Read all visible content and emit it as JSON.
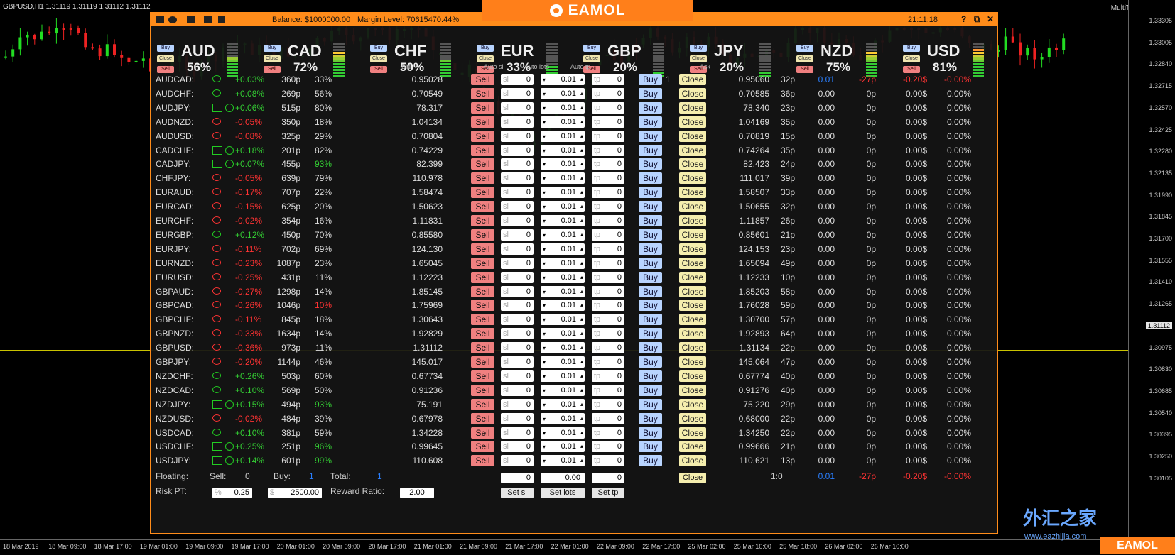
{
  "symbol_info": "GBPUSD,H1  1.31119 1.31119 1.31112 1.31112",
  "multitrader_label": "MultiTrader",
  "brand": "EAMOL",
  "watermark": {
    "text": "外汇之家",
    "url": "www.eazhijia.com"
  },
  "price_scale": [
    "1.33305",
    "1.33005",
    "1.32840",
    "1.32715",
    "1.32570",
    "1.32425",
    "1.32280",
    "1.32135",
    "1.31990",
    "1.31845",
    "1.31700",
    "1.31555",
    "1.31410",
    "1.31265",
    "1.31112",
    "1.30975",
    "1.30830",
    "1.30685",
    "1.30540",
    "1.30395",
    "1.30250",
    "1.30105"
  ],
  "time_scale": [
    "18 Mar 2019",
    "18 Mar 09:00",
    "18 Mar 17:00",
    "19 Mar 01:00",
    "19 Mar 09:00",
    "19 Mar 17:00",
    "20 Mar 01:00",
    "20 Mar 09:00",
    "20 Mar 17:00",
    "21 Mar 01:00",
    "21 Mar 09:00",
    "21 Mar 17:00",
    "22 Mar 01:00",
    "22 Mar 09:00",
    "22 Mar 17:00",
    "25 Mar 02:00",
    "25 Mar 10:00",
    "25 Mar 18:00",
    "26 Mar 02:00",
    "26 Mar 10:00"
  ],
  "titlebar": {
    "balance": "Balance: $1000000.00",
    "margin": "Margin Level: 70615470.44%",
    "time": "21:11:18",
    "help": "?",
    "restore": "⧉",
    "close": "✕"
  },
  "currencies": [
    {
      "name": "AUD",
      "pct": "56%",
      "buy": "Buy",
      "close": "Close",
      "sell": "Sell",
      "level": 0.56
    },
    {
      "name": "CAD",
      "pct": "72%",
      "buy": "Buy",
      "close": "Close",
      "sell": "Sell",
      "level": 0.72
    },
    {
      "name": "CHF",
      "pct": "50%",
      "buy": "Buy",
      "close": "Close",
      "sell": "Sell",
      "level": 0.5
    },
    {
      "name": "EUR",
      "pct": "33%",
      "buy": "Buy",
      "close": "Close",
      "sell": "Sell",
      "level": 0.33
    },
    {
      "name": "GBP",
      "pct": "20%",
      "buy": "Buy",
      "close": "Close",
      "sell": "Sell",
      "level": 0.2
    },
    {
      "name": "JPY",
      "pct": "20%",
      "buy": "Buy",
      "close": "Close",
      "sell": "Sell",
      "level": 0.2
    },
    {
      "name": "NZD",
      "pct": "75%",
      "buy": "Buy",
      "close": "Close",
      "sell": "Sell",
      "level": 0.75
    },
    {
      "name": "USD",
      "pct": "81%",
      "buy": "Buy",
      "close": "Close",
      "sell": "Sell",
      "level": 0.81
    }
  ],
  "headers": {
    "bid": "Bid",
    "auto_sl": "Auto sl",
    "auto_lots": "Auto lots",
    "auto_tp": "Auto tp",
    "ask": "Ask"
  },
  "labels": {
    "sell": "Sell",
    "buy": "Buy",
    "close": "Close",
    "sl": "sl",
    "tp": "tp"
  },
  "rows": [
    {
      "pair": "AUDCAD:",
      "chg": "+0.03%",
      "sp": "360p",
      "pct": "33%",
      "bid": "0.95028",
      "sl": "0",
      "lots": "0.01",
      "tp": "0",
      "ask": "0.95060",
      "asp": "32p",
      "pnl": "0.01",
      "pips": "-27p",
      "usd": "-0.20$",
      "ppc": "-0.00%",
      "ord": "1",
      "up": true
    },
    {
      "pair": "AUDCHF:",
      "chg": "+0.08%",
      "sp": "269p",
      "pct": "56%",
      "bid": "0.70549",
      "sl": "0",
      "lots": "0.01",
      "tp": "0",
      "ask": "0.70585",
      "asp": "36p",
      "pnl": "0.00",
      "pips": "0p",
      "usd": "0.00$",
      "ppc": "0.00%",
      "up": true
    },
    {
      "pair": "AUDJPY:",
      "chg": "+0.06%",
      "sp": "515p",
      "pct": "80%",
      "bid": "78.317",
      "sl": "0",
      "lots": "0.01",
      "tp": "0",
      "ask": "78.340",
      "asp": "23p",
      "pnl": "0.00",
      "pips": "0p",
      "usd": "0.00$",
      "ppc": "0.00%",
      "up": true,
      "sq": true
    },
    {
      "pair": "AUDNZD:",
      "chg": "-0.05%",
      "sp": "350p",
      "pct": "18%",
      "bid": "1.04134",
      "sl": "0",
      "lots": "0.01",
      "tp": "0",
      "ask": "1.04169",
      "asp": "35p",
      "pnl": "0.00",
      "pips": "0p",
      "usd": "0.00$",
      "ppc": "0.00%",
      "up": false
    },
    {
      "pair": "AUDUSD:",
      "chg": "-0.08%",
      "sp": "325p",
      "pct": "29%",
      "bid": "0.70804",
      "sl": "0",
      "lots": "0.01",
      "tp": "0",
      "ask": "0.70819",
      "asp": "15p",
      "pnl": "0.00",
      "pips": "0p",
      "usd": "0.00$",
      "ppc": "0.00%",
      "up": false
    },
    {
      "pair": "CADCHF:",
      "chg": "+0.18%",
      "sp": "201p",
      "pct": "82%",
      "bid": "0.74229",
      "sl": "0",
      "lots": "0.01",
      "tp": "0",
      "ask": "0.74264",
      "asp": "35p",
      "pnl": "0.00",
      "pips": "0p",
      "usd": "0.00$",
      "ppc": "0.00%",
      "up": true,
      "sq": true
    },
    {
      "pair": "CADJPY:",
      "chg": "+0.07%",
      "sp": "455p",
      "pct": "93%",
      "pc": "g",
      "bid": "82.399",
      "sl": "0",
      "lots": "0.01",
      "tp": "0",
      "ask": "82.423",
      "asp": "24p",
      "pnl": "0.00",
      "pips": "0p",
      "usd": "0.00$",
      "ppc": "0.00%",
      "up": true,
      "sq": true
    },
    {
      "pair": "CHFJPY:",
      "chg": "-0.05%",
      "sp": "639p",
      "pct": "79%",
      "bid": "110.978",
      "sl": "0",
      "lots": "0.01",
      "tp": "0",
      "ask": "111.017",
      "asp": "39p",
      "pnl": "0.00",
      "pips": "0p",
      "usd": "0.00$",
      "ppc": "0.00%",
      "up": false
    },
    {
      "pair": "EURAUD:",
      "chg": "-0.17%",
      "sp": "707p",
      "pct": "22%",
      "bid": "1.58474",
      "sl": "0",
      "lots": "0.01",
      "tp": "0",
      "ask": "1.58507",
      "asp": "33p",
      "pnl": "0.00",
      "pips": "0p",
      "usd": "0.00$",
      "ppc": "0.00%",
      "up": false
    },
    {
      "pair": "EURCAD:",
      "chg": "-0.15%",
      "sp": "625p",
      "pct": "20%",
      "bid": "1.50623",
      "sl": "0",
      "lots": "0.01",
      "tp": "0",
      "ask": "1.50655",
      "asp": "32p",
      "pnl": "0.00",
      "pips": "0p",
      "usd": "0.00$",
      "ppc": "0.00%",
      "up": false
    },
    {
      "pair": "EURCHF:",
      "chg": "-0.02%",
      "sp": "354p",
      "pct": "16%",
      "bid": "1.11831",
      "sl": "0",
      "lots": "0.01",
      "tp": "0",
      "ask": "1.11857",
      "asp": "26p",
      "pnl": "0.00",
      "pips": "0p",
      "usd": "0.00$",
      "ppc": "0.00%",
      "up": false
    },
    {
      "pair": "EURGBP:",
      "chg": "+0.12%",
      "sp": "450p",
      "pct": "70%",
      "bid": "0.85580",
      "sl": "0",
      "lots": "0.01",
      "tp": "0",
      "ask": "0.85601",
      "asp": "21p",
      "pnl": "0.00",
      "pips": "0p",
      "usd": "0.00$",
      "ppc": "0.00%",
      "up": true
    },
    {
      "pair": "EURJPY:",
      "chg": "-0.11%",
      "sp": "702p",
      "pct": "69%",
      "bid": "124.130",
      "sl": "0",
      "lots": "0.01",
      "tp": "0",
      "ask": "124.153",
      "asp": "23p",
      "pnl": "0.00",
      "pips": "0p",
      "usd": "0.00$",
      "ppc": "0.00%",
      "up": false
    },
    {
      "pair": "EURNZD:",
      "chg": "-0.23%",
      "sp": "1087p",
      "pct": "23%",
      "bid": "1.65045",
      "sl": "0",
      "lots": "0.01",
      "tp": "0",
      "ask": "1.65094",
      "asp": "49p",
      "pnl": "0.00",
      "pips": "0p",
      "usd": "0.00$",
      "ppc": "0.00%",
      "up": false
    },
    {
      "pair": "EURUSD:",
      "chg": "-0.25%",
      "sp": "431p",
      "pct": "11%",
      "bid": "1.12223",
      "sl": "0",
      "lots": "0.01",
      "tp": "0",
      "ask": "1.12233",
      "asp": "10p",
      "pnl": "0.00",
      "pips": "0p",
      "usd": "0.00$",
      "ppc": "0.00%",
      "up": false
    },
    {
      "pair": "GBPAUD:",
      "chg": "-0.27%",
      "sp": "1298p",
      "pct": "14%",
      "bid": "1.85145",
      "sl": "0",
      "lots": "0.01",
      "tp": "0",
      "ask": "1.85203",
      "asp": "58p",
      "pnl": "0.00",
      "pips": "0p",
      "usd": "0.00$",
      "ppc": "0.00%",
      "up": false
    },
    {
      "pair": "GBPCAD:",
      "chg": "-0.26%",
      "sp": "1046p",
      "pct": "10%",
      "pc": "r",
      "bid": "1.75969",
      "sl": "0",
      "lots": "0.01",
      "tp": "0",
      "ask": "1.76028",
      "asp": "59p",
      "pnl": "0.00",
      "pips": "0p",
      "usd": "0.00$",
      "ppc": "0.00%",
      "up": false
    },
    {
      "pair": "GBPCHF:",
      "chg": "-0.11%",
      "sp": "845p",
      "pct": "18%",
      "bid": "1.30643",
      "sl": "0",
      "lots": "0.01",
      "tp": "0",
      "ask": "1.30700",
      "asp": "57p",
      "pnl": "0.00",
      "pips": "0p",
      "usd": "0.00$",
      "ppc": "0.00%",
      "up": false
    },
    {
      "pair": "GBPNZD:",
      "chg": "-0.33%",
      "sp": "1634p",
      "pct": "14%",
      "bid": "1.92829",
      "sl": "0",
      "lots": "0.01",
      "tp": "0",
      "ask": "1.92893",
      "asp": "64p",
      "pnl": "0.00",
      "pips": "0p",
      "usd": "0.00$",
      "ppc": "0.00%",
      "up": false
    },
    {
      "pair": "GBPUSD:",
      "chg": "-0.36%",
      "sp": "973p",
      "pct": "11%",
      "bid": "1.31112",
      "sl": "0",
      "lots": "0.01",
      "tp": "0",
      "ask": "1.31134",
      "asp": "22p",
      "pnl": "0.00",
      "pips": "0p",
      "usd": "0.00$",
      "ppc": "0.00%",
      "up": false
    },
    {
      "pair": "GBPJPY:",
      "chg": "-0.20%",
      "sp": "1144p",
      "pct": "46%",
      "bid": "145.017",
      "sl": "0",
      "lots": "0.01",
      "tp": "0",
      "ask": "145.064",
      "asp": "47p",
      "pnl": "0.00",
      "pips": "0p",
      "usd": "0.00$",
      "ppc": "0.00%",
      "up": false
    },
    {
      "pair": "NZDCHF:",
      "chg": "+0.26%",
      "sp": "503p",
      "pct": "60%",
      "bid": "0.67734",
      "sl": "0",
      "lots": "0.01",
      "tp": "0",
      "ask": "0.67774",
      "asp": "40p",
      "pnl": "0.00",
      "pips": "0p",
      "usd": "0.00$",
      "ppc": "0.00%",
      "up": true
    },
    {
      "pair": "NZDCAD:",
      "chg": "+0.10%",
      "sp": "569p",
      "pct": "50%",
      "bid": "0.91236",
      "sl": "0",
      "lots": "0.01",
      "tp": "0",
      "ask": "0.91276",
      "asp": "40p",
      "pnl": "0.00",
      "pips": "0p",
      "usd": "0.00$",
      "ppc": "0.00%",
      "up": true
    },
    {
      "pair": "NZDJPY:",
      "chg": "+0.15%",
      "sp": "494p",
      "pct": "93%",
      "pc": "g",
      "bid": "75.191",
      "sl": "0",
      "lots": "0.01",
      "tp": "0",
      "ask": "75.220",
      "asp": "29p",
      "pnl": "0.00",
      "pips": "0p",
      "usd": "0.00$",
      "ppc": "0.00%",
      "up": true,
      "sq": true
    },
    {
      "pair": "NZDUSD:",
      "chg": "-0.02%",
      "sp": "484p",
      "pct": "39%",
      "bid": "0.67978",
      "sl": "0",
      "lots": "0.01",
      "tp": "0",
      "ask": "0.68000",
      "asp": "22p",
      "pnl": "0.00",
      "pips": "0p",
      "usd": "0.00$",
      "ppc": "0.00%",
      "up": false
    },
    {
      "pair": "USDCAD:",
      "chg": "+0.10%",
      "sp": "381p",
      "pct": "59%",
      "bid": "1.34228",
      "sl": "0",
      "lots": "0.01",
      "tp": "0",
      "ask": "1.34250",
      "asp": "22p",
      "pnl": "0.00",
      "pips": "0p",
      "usd": "0.00$",
      "ppc": "0.00%",
      "up": true
    },
    {
      "pair": "USDCHF:",
      "chg": "+0.25%",
      "sp": "251p",
      "pct": "96%",
      "pc": "g",
      "bid": "0.99645",
      "sl": "0",
      "lots": "0.01",
      "tp": "0",
      "ask": "0.99666",
      "asp": "21p",
      "pnl": "0.00",
      "pips": "0p",
      "usd": "0.00$",
      "ppc": "0.00%",
      "up": true,
      "sq": true
    },
    {
      "pair": "USDJPY:",
      "chg": "+0.14%",
      "sp": "601p",
      "pct": "99%",
      "pc": "g",
      "bid": "110.608",
      "sl": "0",
      "lots": "0.01",
      "tp": "0",
      "ask": "110.621",
      "asp": "13p",
      "pnl": "0.00",
      "pips": "0p",
      "usd": "0.00$",
      "ppc": "0.00%",
      "up": true,
      "sq": true
    }
  ],
  "footer": {
    "floating": "Floating:",
    "sell_label": "Sell:",
    "sell_val": "0",
    "buy_label": "Buy:",
    "buy_val": "1",
    "total_label": "Total:",
    "total_val": "1",
    "sl_val": "0",
    "lots_val": "0.00",
    "tp_val": "0",
    "close": "Close",
    "ratio": "1:0",
    "pnl": "0.01",
    "pips": "-27p",
    "usd": "-0.20$",
    "ppc": "-0.00%",
    "risk_label": "Risk PT:",
    "risk_pct_sym": "%",
    "risk_pct": "0.25",
    "risk_usd_sym": "$",
    "risk_usd": "2500.00",
    "reward_label": "Reward Ratio:",
    "reward": "2.00",
    "set_sl": "Set sl",
    "set_lots": "Set lots",
    "set_tp": "Set tp"
  }
}
